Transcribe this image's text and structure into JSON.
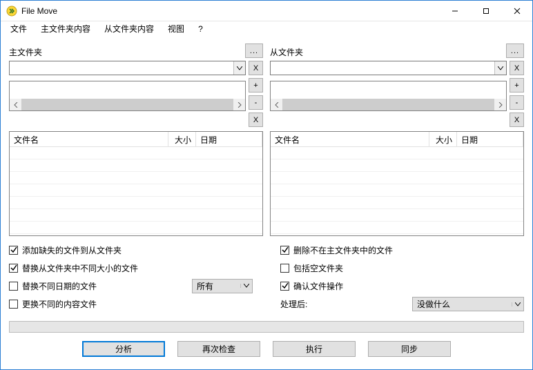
{
  "title": "File Move",
  "menu": {
    "file": "文件",
    "master": "主文件夹内容",
    "slave": "从文件夹内容",
    "view": "视图",
    "help": "?"
  },
  "panels": {
    "master": {
      "label": "主文件夹"
    },
    "slave": {
      "label": "从文件夹"
    }
  },
  "side_buttons": {
    "x": "X",
    "plus": "+",
    "minus": "-"
  },
  "grid_headers": {
    "name": "文件名",
    "size": "大小",
    "date": "日期"
  },
  "options_left": {
    "add_missing": {
      "label": "添加缺失的文件到从文件夹",
      "checked": true
    },
    "replace_size": {
      "label": "替换从文件夹中不同大小的文件",
      "checked": true
    },
    "replace_date": {
      "label": "替换不同日期的文件",
      "checked": false
    },
    "replace_content": {
      "label": "更换不同的内容文件",
      "checked": false
    },
    "date_filter_value": "所有"
  },
  "options_right": {
    "delete_missing": {
      "label": "删除不在主文件夹中的文件",
      "checked": true
    },
    "include_empty": {
      "label": "包括空文件夹",
      "checked": false
    },
    "confirm_ops": {
      "label": "确认文件操作",
      "checked": true
    },
    "after_label": "处理后:",
    "after_value": "没做什么"
  },
  "buttons": {
    "analyze": "分析",
    "recheck": "再次检查",
    "execute": "执行",
    "sync": "同步"
  },
  "browse": "..."
}
